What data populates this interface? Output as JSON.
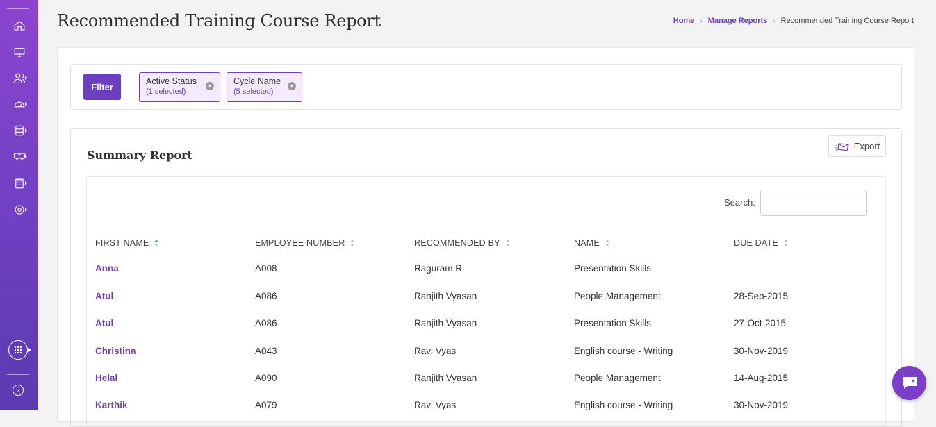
{
  "header": {
    "title": "Recommended Training Course Report",
    "breadcrumb": {
      "home": "Home",
      "manage": "Manage Reports",
      "current": "Recommended Training Course Report"
    }
  },
  "filter": {
    "button_label": "Filter",
    "chips": [
      {
        "title": "Active Status",
        "sub": "(1 selected)"
      },
      {
        "title": "Cycle Name",
        "sub": "(5 selected)"
      }
    ]
  },
  "summary": {
    "title": "Summary Report",
    "export_label": "Export",
    "search_label": "Search:",
    "columns": [
      "FIRST NAME",
      "EMPLOYEE NUMBER",
      "RECOMMENDED BY",
      "NAME",
      "DUE DATE"
    ],
    "rows": [
      [
        "Anna",
        "A008",
        "Raguram R",
        "Presentation Skills",
        ""
      ],
      [
        "Atul",
        "A086",
        "Ranjith Vyasan",
        "People Management",
        "28-Sep-2015"
      ],
      [
        "Atul",
        "A086",
        "Ranjith Vyasan",
        "Presentation Skills",
        "27-Oct-2015"
      ],
      [
        "Christina",
        "A043",
        "Ravi Vyas",
        "English course - Writing",
        "30-Nov-2019"
      ],
      [
        "Helal",
        "A090",
        "Ranjith Vyasan",
        "People Management",
        "14-Aug-2015"
      ],
      [
        "Karthik",
        "A079",
        "Ravi Vyas",
        "English course - Writing",
        "30-Nov-2019"
      ]
    ]
  },
  "sidebar": {
    "icons": [
      "home-icon",
      "monitor-icon",
      "users-icon",
      "dashboard-icon",
      "database-icon",
      "handshake-icon",
      "clipboard-icon",
      "settings-icon",
      "apps-grid-icon",
      "expand-icon"
    ]
  },
  "colors": {
    "accent": "#6d3fbf",
    "sidebar": "#7a42c8"
  }
}
